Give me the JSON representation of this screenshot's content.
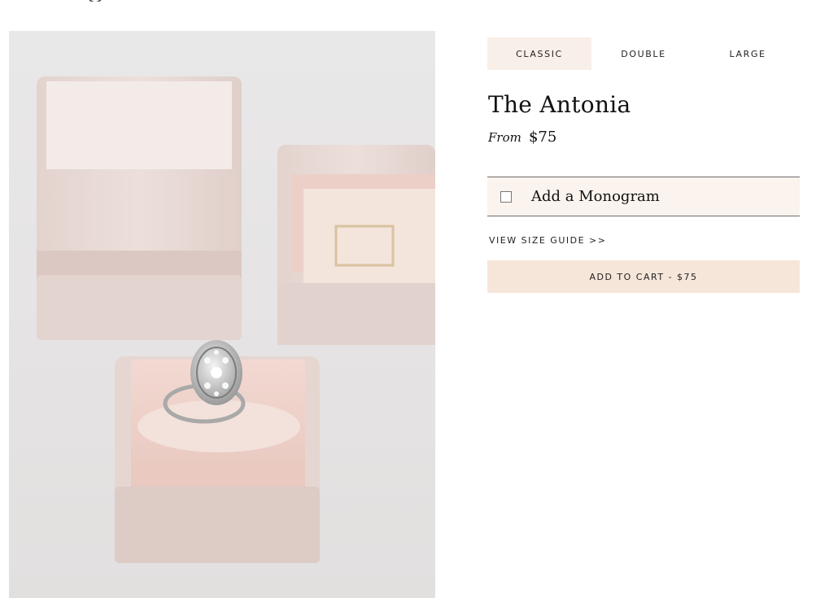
{
  "variants": {
    "tabs": [
      {
        "label": "CLASSIC"
      },
      {
        "label": "DOUBLE"
      },
      {
        "label": "LARGE"
      }
    ],
    "selected": "CLASSIC"
  },
  "product": {
    "title": "The Antonia",
    "price_prefix": "From",
    "price": "$75",
    "image_icon": "ring-box-photo"
  },
  "monogram": {
    "label": "Add a Monogram",
    "checked": false
  },
  "size_guide": {
    "label": "VIEW SIZE GUIDE >>"
  },
  "cart": {
    "button_label": "ADD TO CART - $75"
  },
  "colors": {
    "tab_active_bg": "#f8efe8",
    "monogram_bg": "#fbf3ed",
    "cart_button_bg": "#f6e6da",
    "text": "#111111"
  }
}
